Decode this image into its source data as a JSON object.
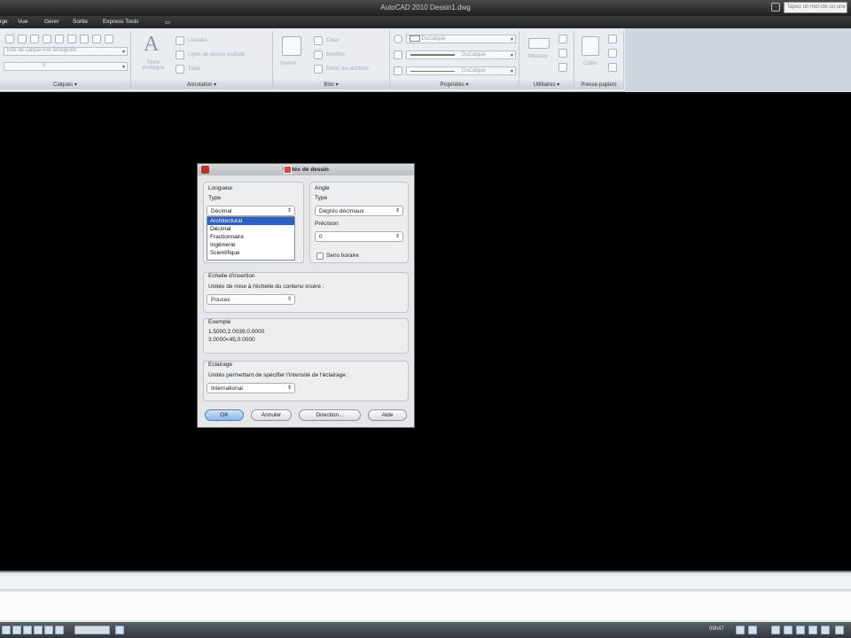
{
  "titlebar": {
    "title": "AutoCAD 2010   Dessin1.dwg",
    "search_placeholder": "Tapez un mot-clé ou une phrase"
  },
  "menubar": {
    "items": [
      "ige",
      "Vue",
      "Gérer",
      "Sortie",
      "Express Tools",
      "▭"
    ]
  },
  "ribbon": {
    "panels": [
      {
        "label": "Calques ▾"
      },
      {
        "label": "Annotation ▾"
      },
      {
        "label": "Bloc ▾"
      },
      {
        "label": "Propriétés ▾"
      },
      {
        "label": "Utilitaires ▾"
      },
      {
        "label": "Presse-papiers"
      }
    ],
    "layer_state": "Etat de calque non enregistré",
    "layer_current": "0",
    "text_label": "Texte multiligne",
    "line_label": "Linéaire",
    "leader_label": "Ligne de repère multiple",
    "table_label": "Table",
    "insert_label": "Insérer",
    "create_label": "Créer",
    "edit_label": "Modifier",
    "block_attr_label": "Editer les attributs",
    "color_value": "DuCalque",
    "linetype_value": "DuCalque",
    "lineweight_value": "DuCalque",
    "measure_label": "Mesurer",
    "paste_label": "Coller"
  },
  "statusbar": {
    "coords": "09h47"
  },
  "dialog": {
    "title": "Unités de dessin",
    "length": {
      "group_label": "Longueur",
      "type_label": "Type",
      "type_value": "Décimal",
      "options": [
        "Architectural",
        "Décimal",
        "Fractionnaire",
        "Ingénierie",
        "Scientifique"
      ],
      "selected_option": "Architectural"
    },
    "angle": {
      "group_label": "Angle",
      "type_label": "Type",
      "type_value": "Degrés décimaux",
      "precision_label": "Précision",
      "precision_value": "0",
      "clockwise_label": "Sens horaire"
    },
    "insert_scale": {
      "group_label": "Echelle d'insertion",
      "description": "Unités de mise à l'échelle du contenu inséré :",
      "value": "Pouces"
    },
    "sample": {
      "group_label": "Exemple",
      "line1": "1.5000,2.0039,0.0000",
      "line2": "3.0000<45,0.0000"
    },
    "lighting": {
      "group_label": "Eclairage",
      "description": "Unités permettant de spécifier l'intensité de l'éclairage :",
      "value": "International"
    },
    "buttons": {
      "ok": "OK",
      "cancel": "Annuler",
      "direction": "Direction...",
      "help": "Aide"
    }
  }
}
